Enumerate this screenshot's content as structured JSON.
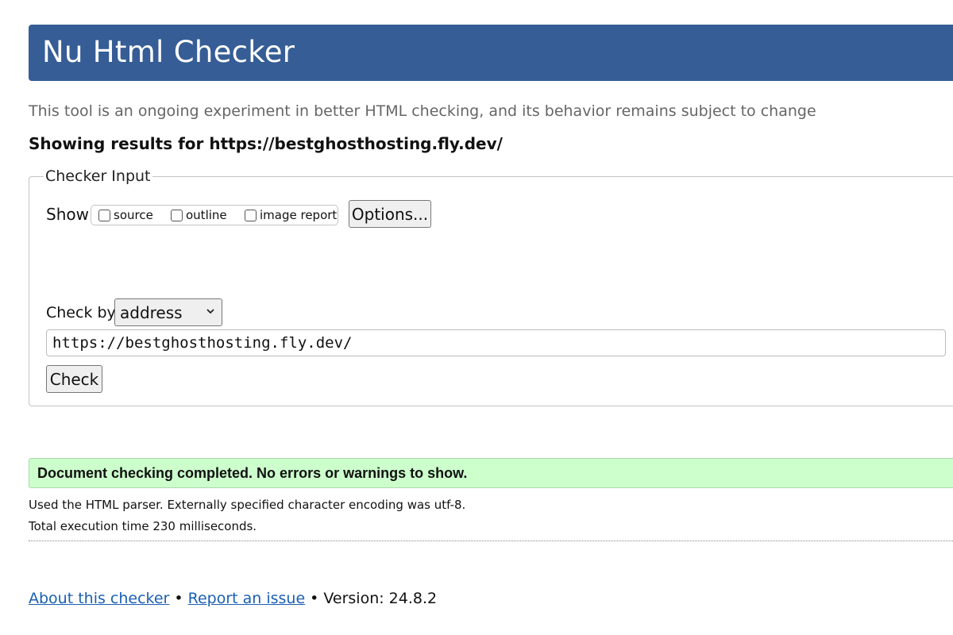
{
  "header": {
    "title": "Nu Html Checker"
  },
  "subtitle": "This tool is an ongoing experiment in better HTML checking, and its behavior remains subject to change",
  "showing_results": "Showing results for https://bestghosthosting.fly.dev/",
  "checker_input": {
    "legend": "Checker Input",
    "show_label": "Show",
    "show_options": [
      {
        "label": "source",
        "checked": false
      },
      {
        "label": "outline",
        "checked": false
      },
      {
        "label": "image report",
        "checked": false
      }
    ],
    "options_button": "Options...",
    "check_by_label": "Check by",
    "check_by_selected": "address",
    "url_value": "https://bestghosthosting.fly.dev/",
    "check_button": "Check"
  },
  "result": {
    "message": "Document checking completed. No errors or warnings to show.",
    "parser_info": "Used the HTML parser. Externally specified character encoding was utf-8.",
    "execution_time": "Total execution time 230 milliseconds."
  },
  "footer": {
    "about_link": "About this checker",
    "bullet": "•",
    "report_link": "Report an issue",
    "version": "Version: 24.8.2"
  },
  "colors": {
    "banner": "#365d95",
    "success_bg": "#ccffcc",
    "link": "#1a5fb4"
  }
}
